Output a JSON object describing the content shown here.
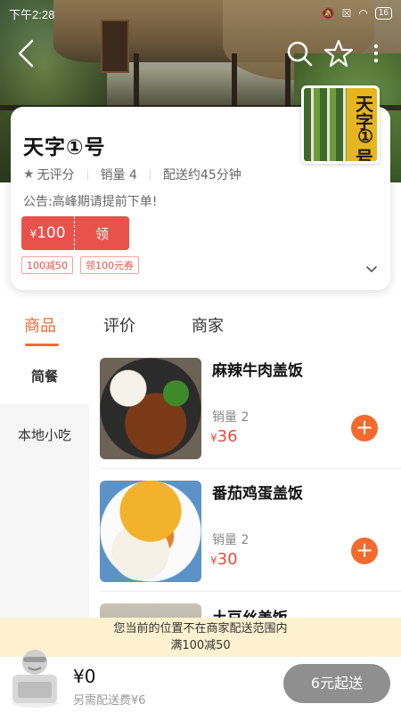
{
  "status_bar": {
    "time": "下午2:28",
    "battery": "16"
  },
  "nav": {
    "back_icon": "back-arrow-icon",
    "search_icon": "search-icon",
    "favorite_icon": "star-outline-icon",
    "more_icon": "more-vertical-icon"
  },
  "shop": {
    "name": "天字①号",
    "logo_chars": [
      "天",
      "字",
      "①",
      "号"
    ],
    "rating": "无评分",
    "sales": "销量 4",
    "delivery_time": "配送约45分钟",
    "notice": "公告:高峰期请提前下单!",
    "coupon": {
      "currency": "¥",
      "amount": "100",
      "action": "领"
    },
    "tags": [
      "100减50",
      "领100元券"
    ]
  },
  "tabs": [
    {
      "label": "商品",
      "active": true
    },
    {
      "label": "评价",
      "active": false
    },
    {
      "label": "商家",
      "active": false
    }
  ],
  "categories": [
    {
      "label": "简餐",
      "active": true
    },
    {
      "label": "本地小吃",
      "active": false
    }
  ],
  "foods": [
    {
      "name": "麻辣牛肉盖饭",
      "sales": "销量 2",
      "currency": "¥",
      "price": "36"
    },
    {
      "name": "番茄鸡蛋盖饭",
      "sales": "销量 2",
      "currency": "¥",
      "price": "30"
    },
    {
      "name": "土豆丝盖饭"
    }
  ],
  "out_of_range": {
    "line1": "您当前的位置不在商家配送范围内",
    "line2": "满100减50"
  },
  "cart": {
    "total": "¥0",
    "delivery_fee": "另需配送费¥6",
    "min_order": "6元起送"
  },
  "colors": {
    "accent": "#f26a2e",
    "price_red": "#e94b3c",
    "coupon_red": "#e9524a",
    "notice_bg": "#fdf1cf"
  }
}
